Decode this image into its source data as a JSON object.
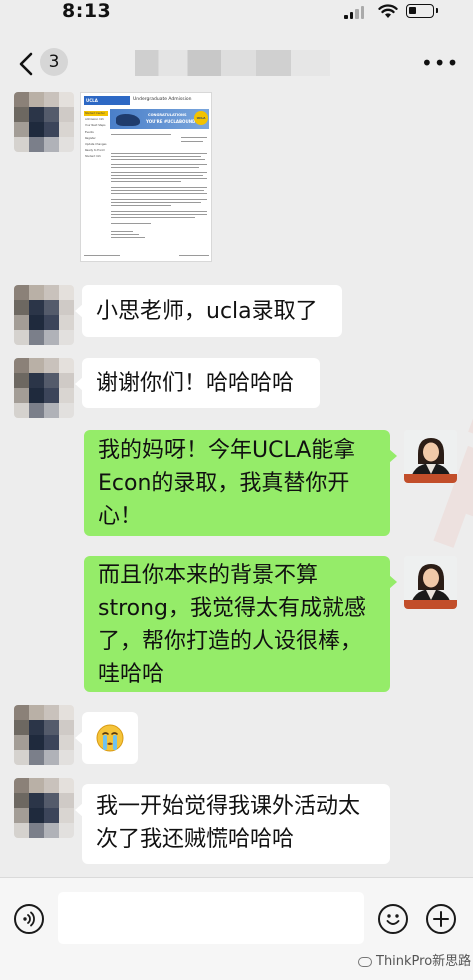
{
  "status_bar": {
    "time": "8:13"
  },
  "nav": {
    "unread_count": "3",
    "more_label": "•••"
  },
  "letter": {
    "header": "Undergraduate Admission",
    "banner_line1": "CONGRATULATIONS",
    "banner_line2": "YOU'RE #UCLABOUND",
    "seal_text": "UCLA",
    "side_items": [
      "Student Center",
      "Admission Info",
      "Your Next Steps",
      "Events",
      "Register",
      "Update Changes",
      "Ready to Enroll",
      "Student Info"
    ]
  },
  "messages": [
    {
      "sender": "contact",
      "type": "image",
      "text": ""
    },
    {
      "sender": "contact",
      "type": "text",
      "text": "小思老师，ucla录取了"
    },
    {
      "sender": "contact",
      "type": "text",
      "text": "谢谢你们！哈哈哈哈"
    },
    {
      "sender": "me",
      "type": "text",
      "lines": [
        "我的妈呀！今年UCLA能拿",
        "Econ的录取，我真替你开",
        "心！"
      ]
    },
    {
      "sender": "me",
      "type": "text",
      "lines": [
        "而且你本来的背景不算",
        "strong，我觉得太有成就感",
        "了，帮你打造的人设很棒，",
        "哇哈哈"
      ]
    },
    {
      "sender": "contact",
      "type": "emoji",
      "text": "😭",
      "emoji_name": "crying-face"
    },
    {
      "sender": "contact",
      "type": "text",
      "lines": [
        "我一开始觉得我课外活动太",
        "次了我还贼慌哈哈哈"
      ]
    }
  ],
  "watermark": {
    "text": "ThinkPro新思路",
    "background_text": "ThinkPro"
  },
  "colors": {
    "background": "#ededed",
    "green_bubble": "#95ec69",
    "white_bubble": "#ffffff"
  }
}
